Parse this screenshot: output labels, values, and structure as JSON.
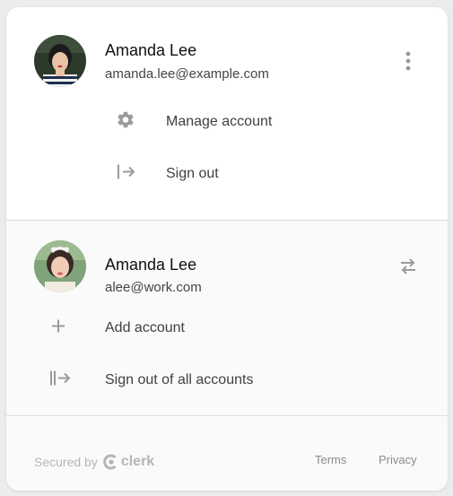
{
  "primary_account": {
    "name": "Amanda Lee",
    "email": "amanda.lee@example.com",
    "menu": [
      {
        "label": "Manage account",
        "icon": "gear-icon"
      },
      {
        "label": "Sign out",
        "icon": "sign-out-icon"
      }
    ]
  },
  "secondary_account": {
    "name": "Amanda Lee",
    "email": "alee@work.com"
  },
  "actions": [
    {
      "label": "Add account",
      "icon": "plus-icon"
    },
    {
      "label": "Sign out of all accounts",
      "icon": "sign-out-all-icon"
    }
  ],
  "footer": {
    "secured_by": "Secured by",
    "brand": "clerk",
    "links": [
      "Terms",
      "Privacy"
    ]
  },
  "colors": {
    "card_background": "#ffffff",
    "muted_background": "#fafafa",
    "divider": "#dcdcdc",
    "icon": "#9a9a9a",
    "text_primary": "#111111",
    "text_secondary": "#444444"
  }
}
